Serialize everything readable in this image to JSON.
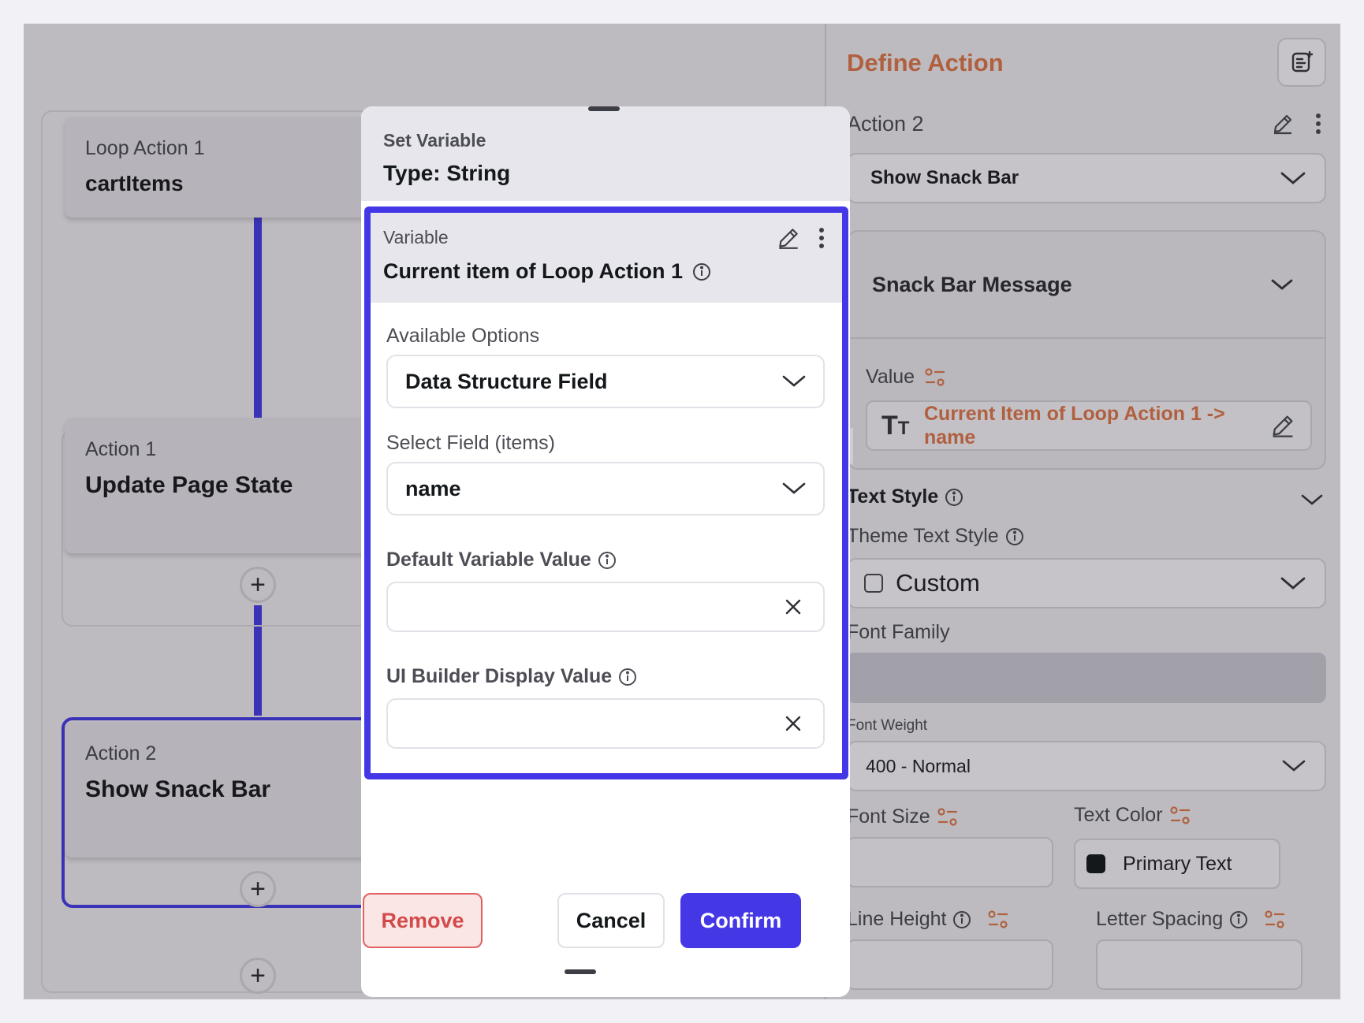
{
  "canvas": {
    "loop_node": {
      "sub": "Loop Action 1",
      "main": "cartItems"
    },
    "action1_node": {
      "sub": "Action 1",
      "main": "Update Page State"
    },
    "action2_node": {
      "sub": "Action 2",
      "main": "Show Snack Bar"
    },
    "add_symbol": "+"
  },
  "modal": {
    "header_sub": "Set Variable",
    "header_title": "Type: String",
    "variable": {
      "label": "Variable",
      "name": "Current item of Loop Action 1"
    },
    "available_options_label": "Available Options",
    "available_options_value": "Data Structure Field",
    "select_field_label": "Select Field (items)",
    "select_field_value": "name",
    "default_value_label": "Default Variable Value",
    "ui_builder_label": "UI Builder Display Value",
    "remove_label": "Remove",
    "cancel_label": "Cancel",
    "confirm_label": "Confirm"
  },
  "right_panel": {
    "title": "Define Action",
    "action_label": "Action 2",
    "action_select": "Show Snack Bar",
    "snackbar_section": "Snack Bar Message",
    "value_label": "Value",
    "value_text": "Current Item of Loop Action 1 -> name",
    "text_style_label": "Text Style",
    "theme_text_style_label": "Theme Text Style",
    "theme_text_style_value": "Custom",
    "font_family_label": "Font Family",
    "font_weight_label": "Font Weight",
    "font_weight_value": "400 - Normal",
    "font_size_label": "Font Size",
    "text_color_label": "Text Color",
    "text_color_value": "Primary Text",
    "line_height_label": "Line Height",
    "letter_spacing_label": "Letter Spacing"
  },
  "colors": {
    "accent": "#4438e6",
    "accent_dark": "#3a33b8",
    "orange_text": "#b0603f",
    "remove_red": "#d34a4a"
  }
}
